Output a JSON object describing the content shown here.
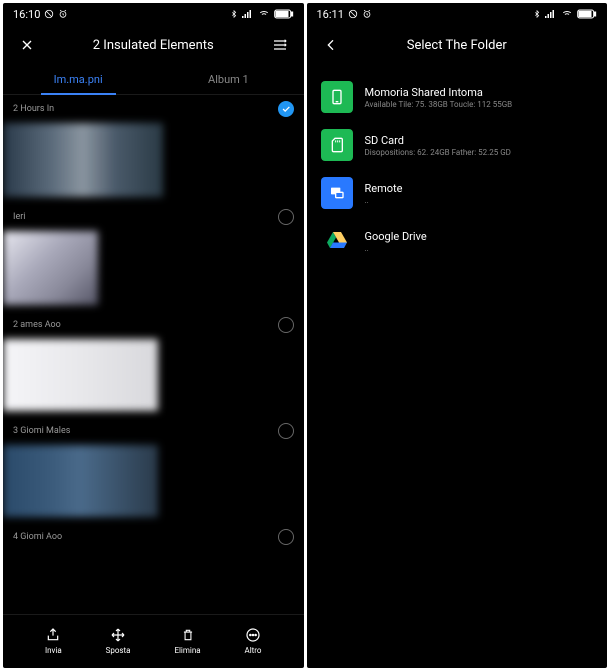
{
  "left": {
    "status": {
      "time": "16:10"
    },
    "header": {
      "title": "2 Insulated Elements"
    },
    "tabs": {
      "tab1": "Im.ma.pni",
      "tab2": "Album 1"
    },
    "sections": {
      "s1": "2 Hours In",
      "s2": "Ieri",
      "s3": "2 ames Aoo",
      "s4": "3 Giomi Males",
      "s5": "4 Giomi Aoo"
    },
    "bottom": {
      "invia": "Invia",
      "sposta": "Sposta",
      "elimina": "Elimina",
      "altro": "Altro"
    }
  },
  "right": {
    "status": {
      "time": "16:11"
    },
    "header": {
      "title": "Select The Folder"
    },
    "folders": {
      "f1": {
        "title": "Momoria Shared Intoma",
        "sub": "Available Tile: 75. 38GB Toucle: 112 55GB"
      },
      "f2": {
        "title": "SD Card",
        "sub": "Disopositions: 62. 24GB Father: 52.25 GD"
      },
      "f3": {
        "title": "Remote",
        "sub": ".."
      },
      "f4": {
        "title": "Google Drive",
        "sub": ".."
      }
    }
  }
}
